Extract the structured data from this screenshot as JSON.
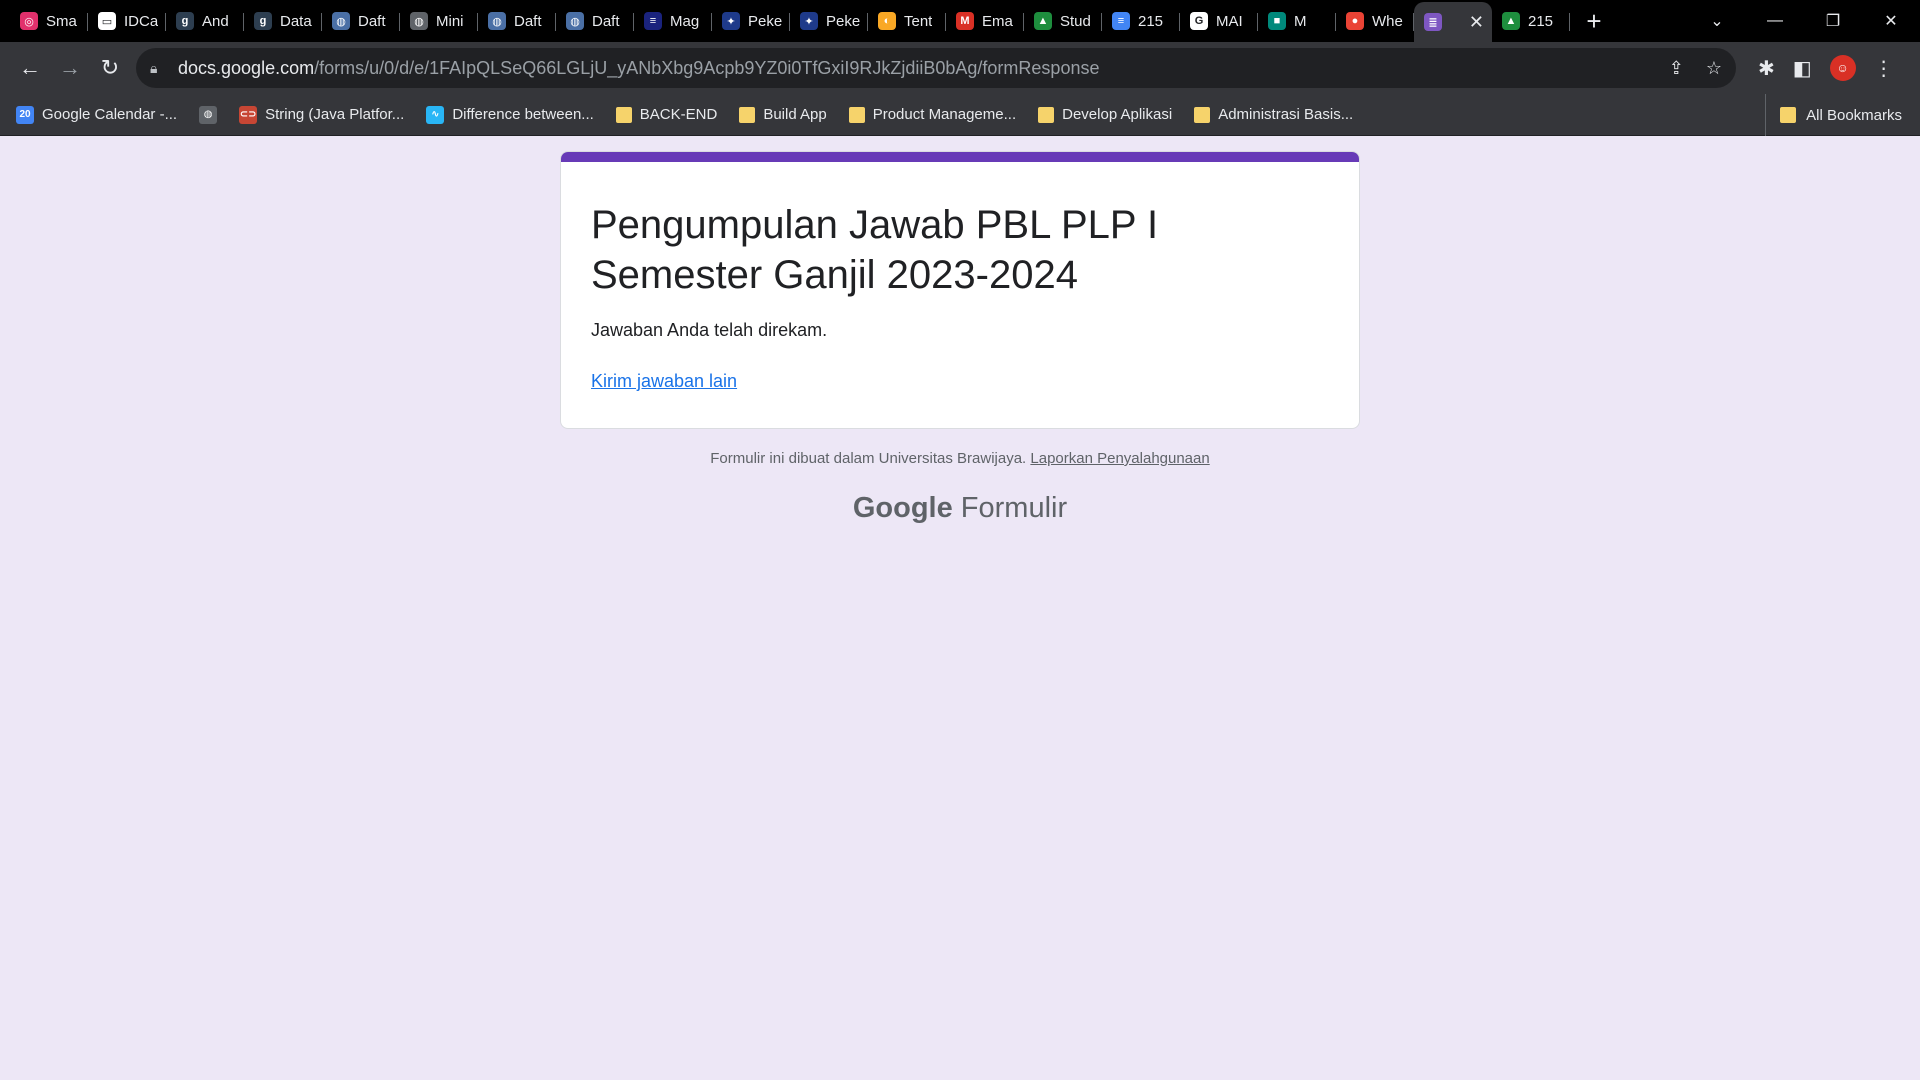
{
  "tabs": [
    {
      "title": "Sma",
      "icon": "instagram-icon",
      "color": "#e1306c",
      "glyph": "◎"
    },
    {
      "title": "IDCa",
      "icon": "idcamp-icon",
      "color": "#ffffff",
      "glyph": "▭"
    },
    {
      "title": "And",
      "icon": "dicoding-icon",
      "color": "#2d3e50",
      "glyph": "g"
    },
    {
      "title": "Data",
      "icon": "dicoding-icon",
      "color": "#2d3e50",
      "glyph": "g"
    },
    {
      "title": "Daft",
      "icon": "globe-icon",
      "color": "#4a6fa5",
      "glyph": "◍"
    },
    {
      "title": "Mini",
      "icon": "globe-icon",
      "color": "#5f6368",
      "glyph": "◍"
    },
    {
      "title": "Daft",
      "icon": "globe-icon",
      "color": "#4a6fa5",
      "glyph": "◍"
    },
    {
      "title": "Daft",
      "icon": "globe-icon",
      "color": "#4a6fa5",
      "glyph": "◍"
    },
    {
      "title": "Mag",
      "icon": "magang-icon",
      "color": "#1a237e",
      "glyph": "≡"
    },
    {
      "title": "Peke",
      "icon": "compass-icon",
      "color": "#1e3a8a",
      "glyph": "✦"
    },
    {
      "title": "Peke",
      "icon": "compass-icon",
      "color": "#1e3a8a",
      "glyph": "✦"
    },
    {
      "title": "Tent",
      "icon": "tent-icon",
      "color": "#f9a825",
      "glyph": "◐"
    },
    {
      "title": "Ema",
      "icon": "gmail-icon",
      "color": "#d93025",
      "glyph": "M"
    },
    {
      "title": "Stud",
      "icon": "drive-icon",
      "color": "#1e8e3e",
      "glyph": "▲"
    },
    {
      "title": "215",
      "icon": "docs-icon",
      "color": "#4285f4",
      "glyph": "≡"
    },
    {
      "title": "MAI",
      "icon": "google-icon",
      "color": "#ffffff",
      "glyph": "G"
    },
    {
      "title": "M",
      "icon": "meet-icon",
      "color": "#00897b",
      "glyph": "■"
    },
    {
      "title": "Whe",
      "icon": "color-wheel-icon",
      "color": "#ea4335",
      "glyph": "●"
    },
    {
      "title": "",
      "icon": "forms-icon",
      "color": "#7e57c2",
      "glyph": "≣",
      "active": true
    },
    {
      "title": "215",
      "icon": "drive-icon",
      "color": "#1e8e3e",
      "glyph": "▲"
    }
  ],
  "window": {
    "minimize": "—",
    "restore": "❐",
    "close": "✕",
    "tab_list": "⌄",
    "new_tab": "+",
    "tab_close": "✕"
  },
  "address": {
    "host": "docs.google.com",
    "path": "/forms/u/0/d/e/1FAIpQLSeQ66LGLjU_yANbXbg9Acpb9YZ0i0TfGxiI9RJkZjdiiB0bAg/formResponse"
  },
  "bookmarks": [
    {
      "label": "Google Calendar -...",
      "kind": "calendar-icon",
      "color": "#4285f4",
      "glyph": "20"
    },
    {
      "label": "",
      "kind": "globe-icon",
      "color": "#5f6368",
      "glyph": "◍"
    },
    {
      "label": "String (Java Platfor...",
      "kind": "oracle-icon",
      "color": "#c74634",
      "glyph": "⊂⊃"
    },
    {
      "label": "Difference between...",
      "kind": "site-icon",
      "color": "#29b6f6",
      "glyph": "∿"
    },
    {
      "label": "BACK-END",
      "kind": "folder-icon"
    },
    {
      "label": "Build App",
      "kind": "folder-icon"
    },
    {
      "label": "Product Manageme...",
      "kind": "folder-icon"
    },
    {
      "label": "Develop Aplikasi",
      "kind": "folder-icon"
    },
    {
      "label": "Administrasi Basis...",
      "kind": "folder-icon"
    }
  ],
  "all_bookmarks": "All Bookmarks",
  "form": {
    "title": "Pengumpulan Jawab PBL PLP I Semester Ganjil 2023-2024",
    "confirmation": "Jawaban Anda telah direkam.",
    "another_link": "Kirim jawaban lain",
    "accent": "#673ab7"
  },
  "footer": {
    "note": "Formulir ini dibuat dalam Universitas Brawijaya.",
    "abuse_link": "Laporkan Penyalahgunaan",
    "brand_google": "Google",
    "brand_product": "Formulir"
  }
}
